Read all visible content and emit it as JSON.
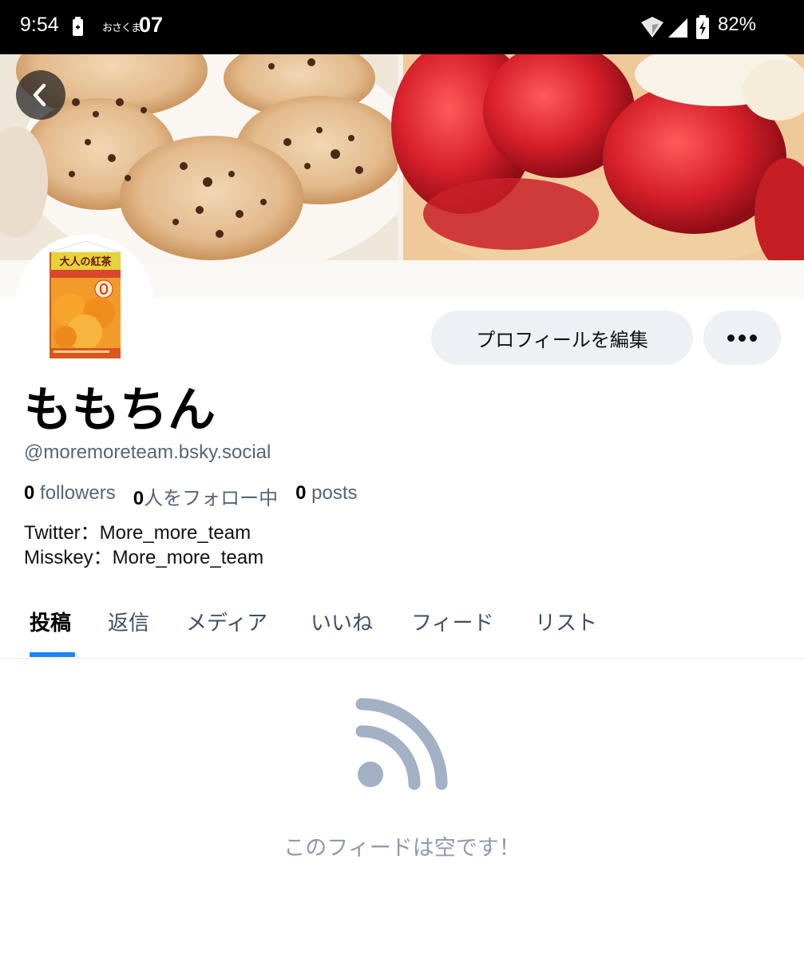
{
  "status_bar": {
    "time": "9:54",
    "app_label": "おさくま",
    "notification_count": "07",
    "battery_percent": "82%"
  },
  "profile": {
    "display_name": "ももちん",
    "handle": "@moremoreteam.bsky.social",
    "edit_button_label": "プロフィールを編集",
    "stats": {
      "followers_count": "0",
      "followers_label": "followers",
      "following_count": "0",
      "following_label": "人をフォロー中",
      "posts_count": "0",
      "posts_label": "posts"
    },
    "bio": "Twitter：More_more_team\nMisskey：More_more_team",
    "avatar_product_text": "大人の紅茶"
  },
  "tabs": [
    {
      "label": "投稿",
      "active": true
    },
    {
      "label": "返信",
      "active": false
    },
    {
      "label": "メディア",
      "active": false
    },
    {
      "label": "いいね",
      "active": false
    },
    {
      "label": "フィード",
      "active": false
    },
    {
      "label": "リスト",
      "active": false
    }
  ],
  "feed": {
    "empty_message": "このフィードは空です！"
  },
  "colors": {
    "accent": "#1d84f2",
    "muted_text": "#556677",
    "empty_text": "#8d9bb0",
    "button_bg": "#edf0f4"
  },
  "icons": {
    "back": "chevron-left-icon",
    "more": "more-horizontal-icon",
    "empty": "rss-feed-icon"
  }
}
